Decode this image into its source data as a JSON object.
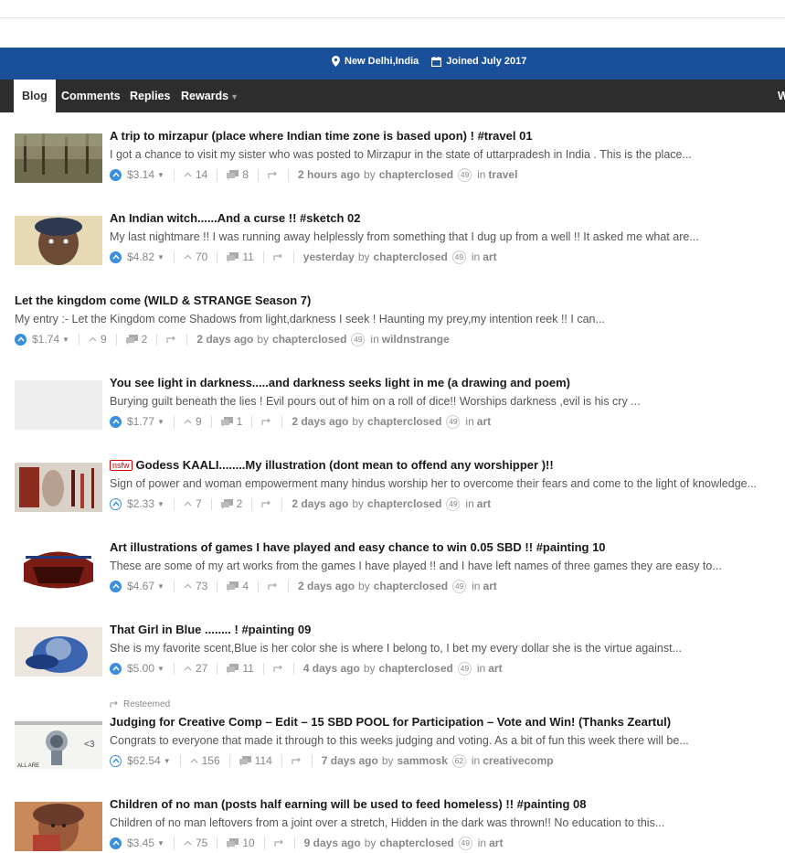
{
  "profile": {
    "location": "New Delhi,India",
    "joined": "Joined July 2017"
  },
  "tabs": [
    {
      "label": "Blog",
      "active": true
    },
    {
      "label": "Comments"
    },
    {
      "label": "Replies"
    },
    {
      "label": "Rewards"
    }
  ],
  "posts": [
    {
      "title": "A trip to mirzapur (place where Indian time zone is based upon) ! #travel 01",
      "excerpt": "I got a chance to visit my sister who was posted to Mirzapur in the state of uttarpradesh in India . This is the place...",
      "payout": "$3.14",
      "votes": "14",
      "comments": "8",
      "time": "2 hours ago",
      "author": "chapterclosed",
      "rep": "49",
      "category": "travel"
    },
    {
      "title": "An Indian witch......And a curse !! #sketch 02",
      "excerpt": "My last nightmare !! I was running away helplessly from something that I dug up from a well !! It asked me what are...",
      "payout": "$4.82",
      "votes": "70",
      "comments": "11",
      "time": "yesterday",
      "author": "chapterclosed",
      "rep": "49",
      "category": "art"
    },
    {
      "title": "Let the kingdom come (WILD & STRANGE Season 7)",
      "excerpt": "My entry :- Let the Kingdom come Shadows from light,darkness I seek ! Haunting my prey,my intention reek !! I can...",
      "payout": "$1.74",
      "votes": "9",
      "comments": "2",
      "time": "2 days ago",
      "author": "chapterclosed",
      "rep": "49",
      "category": "wildnstrange"
    },
    {
      "title": "You see light in darkness.....and darkness seeks light in me (a drawing and poem)",
      "excerpt": "Burying guilt beneath the lies ! Evil pours out of him on a roll of dice!! Worships darkness ,evil is his cry ...",
      "payout": "$1.77",
      "votes": "9",
      "comments": "1",
      "time": "2 days ago",
      "author": "chapterclosed",
      "rep": "49",
      "category": "art"
    },
    {
      "title": "Godess KAALI........My illustration (dont mean to offend any worshipper )!!",
      "nsfw": "nsfw",
      "excerpt": "Sign of power and woman empowerment many hindus worship her to overcome their fears and come to the light of knowledge...",
      "payout": "$2.33",
      "votes": "7",
      "comments": "2",
      "time": "2 days ago",
      "author": "chapterclosed",
      "rep": "49",
      "category": "art"
    },
    {
      "title": "Art illustrations of games I have played and easy chance to win 0.05 SBD !! #painting 10",
      "excerpt": "These are some of my art works from the games I have played !! and I have left names of three games they are easy to...",
      "payout": "$4.67",
      "votes": "73",
      "comments": "4",
      "time": "2 days ago",
      "author": "chapterclosed",
      "rep": "49",
      "category": "art"
    },
    {
      "title": "That Girl in Blue ........ ! #painting 09",
      "excerpt": "She is my favorite scent,Blue is her color she is where I belong to, I bet my every dollar she is the virtue against...",
      "payout": "$5.00",
      "votes": "27",
      "comments": "11",
      "time": "4 days ago",
      "author": "chapterclosed",
      "rep": "49",
      "category": "art"
    },
    {
      "resteemed": "Resteemed",
      "title": "Judging for Creative Comp – Edit – 15 SBD POOL for Participation – Vote and Win! (Thanks Zeartul)",
      "excerpt": "Congrats to everyone that made it through to this weeks judging and voting. As a bit of fun this week there will be...",
      "payout": "$62.54",
      "votes": "156",
      "comments": "114",
      "time": "7 days ago",
      "author": "sammosk",
      "rep": "62",
      "category": "creativecomp"
    },
    {
      "title": "Children of no man (posts half earning will be used to feed homeless) !! #painting 08",
      "excerpt": "Children of no man leftovers from a joint over a stretch, Hidden in the dark was thrown!! No education to this...",
      "payout": "$3.45",
      "votes": "75",
      "comments": "10",
      "time": "9 days ago",
      "author": "chapterclosed",
      "rep": "49",
      "category": "art"
    }
  ],
  "labels": {
    "by": "by",
    "in": "in"
  },
  "colors": {
    "banner": "#1a5099",
    "tabbar": "#2d2d2d",
    "vote": "#3b8fe0"
  }
}
